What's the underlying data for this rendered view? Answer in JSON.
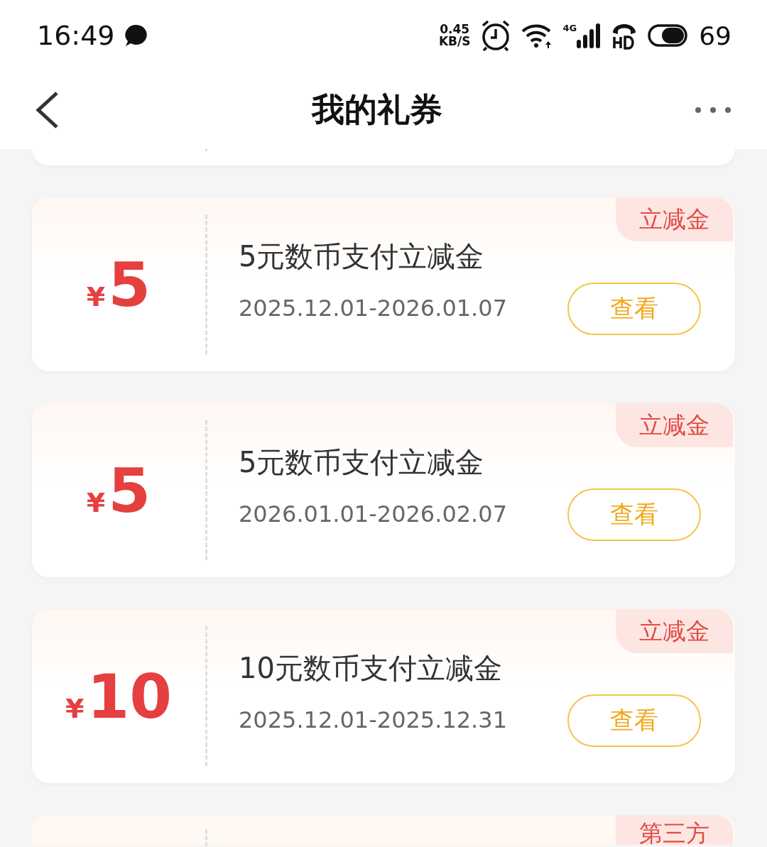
{
  "status_bar": {
    "time": "16:49",
    "speed_value": "0.45",
    "speed_unit": "KB/S",
    "network": "4G",
    "battery_percent": "69"
  },
  "header": {
    "title": "我的礼券"
  },
  "coupons": [
    {
      "currency": "¥",
      "amount": "5",
      "title": "5元数币支付立减金",
      "validity": "2025.12.01-2026.01.07",
      "button": "查看",
      "tag": "立减金"
    },
    {
      "currency": "¥",
      "amount": "5",
      "title": "5元数币支付立减金",
      "validity": "2026.01.01-2026.02.07",
      "button": "查看",
      "tag": "立减金"
    },
    {
      "currency": "¥",
      "amount": "10",
      "title": "10元数币支付立减金",
      "validity": "2025.12.01-2025.12.31",
      "button": "查看",
      "tag": "立减金"
    }
  ],
  "next_coupon": {
    "tag": "第三方"
  }
}
